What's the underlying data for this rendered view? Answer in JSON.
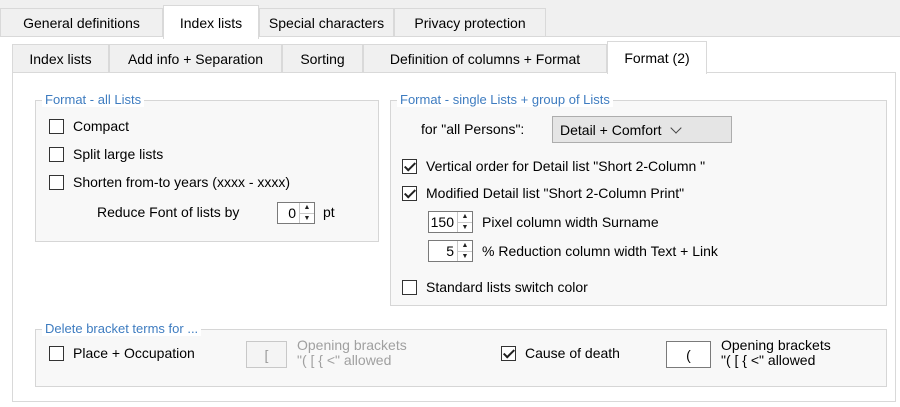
{
  "tabs_main": [
    "General definitions",
    "Index lists",
    "Special characters",
    "Privacy protection"
  ],
  "tabs_sub": [
    "Index lists",
    "Add info + Separation",
    "Sorting",
    "Definition of columns + Format",
    "Format (2)"
  ],
  "format_all": {
    "title": "Format - all Lists",
    "compact": "Compact",
    "split": "Split large lists",
    "shorten": "Shorten from-to years (xxxx - xxxx)",
    "reduce_label": "Reduce Font of lists by",
    "reduce_value": "0",
    "reduce_unit": "pt"
  },
  "format_single": {
    "title": "Format - single Lists + group of Lists",
    "persons_label": "for \"all Persons\":",
    "persons_value": "Detail + Comfort",
    "vertical": "Vertical order for Detail list \"Short 2-Column \"",
    "modified": "Modified Detail list \"Short 2-Column Print\"",
    "pixel_value": "150",
    "pixel_label": "Pixel column width Surname",
    "reduction_value": "5",
    "reduction_label": "% Reduction column width Text + Link",
    "standard": "Standard lists switch color"
  },
  "delete_brackets": {
    "title": "Delete bracket terms for ...",
    "place": "Place + Occupation",
    "place_bracket": "[",
    "place_note1": "Opening brackets",
    "place_note2": "\"( [ { <\" allowed",
    "cause": "Cause of death",
    "cause_bracket": "(",
    "cause_note1": "Opening brackets",
    "cause_note2": "\"( [ { <\" allowed"
  },
  "checks": {
    "compact": false,
    "split": false,
    "shorten": false,
    "vertical": true,
    "modified": true,
    "standard": false,
    "place": false,
    "cause": true
  }
}
